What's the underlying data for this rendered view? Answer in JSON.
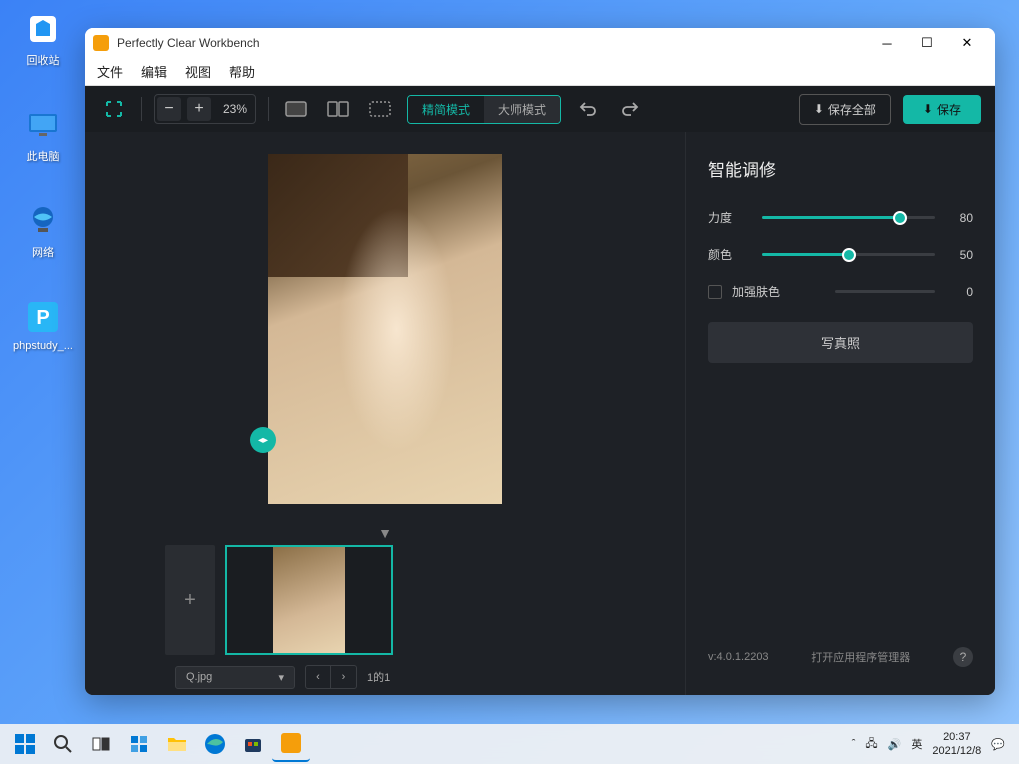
{
  "desktop": {
    "icons": [
      {
        "name": "recycle-bin",
        "label": "回收站"
      },
      {
        "name": "this-pc",
        "label": "此电脑"
      },
      {
        "name": "network",
        "label": "网络"
      },
      {
        "name": "phpstudy",
        "label": "phpstudy_..."
      }
    ]
  },
  "window": {
    "title": "Perfectly Clear Workbench",
    "menu": [
      "文件",
      "编辑",
      "视图",
      "帮助"
    ]
  },
  "toolbar": {
    "zoom_minus": "−",
    "zoom_plus": "+",
    "zoom_label": "23%",
    "mode_simple": "精简模式",
    "mode_master": "大师模式",
    "save_all": "保存全部",
    "save": "保存"
  },
  "filmstrip": {
    "add": "+"
  },
  "bottombar": {
    "filename": "Q.jpg",
    "page": "1的1"
  },
  "panel": {
    "title": "智能调修",
    "sliders": [
      {
        "label": "力度",
        "value": 80
      },
      {
        "label": "颜色",
        "value": 50
      }
    ],
    "checkbox_label": "加强肤色",
    "checkbox_value": 0,
    "preset_button": "写真照",
    "version": "v:4.0.1.2203",
    "manager_link": "打开应用程序管理器"
  },
  "systray": {
    "ime": "英",
    "time": "20:37",
    "date": "2021/12/8"
  }
}
